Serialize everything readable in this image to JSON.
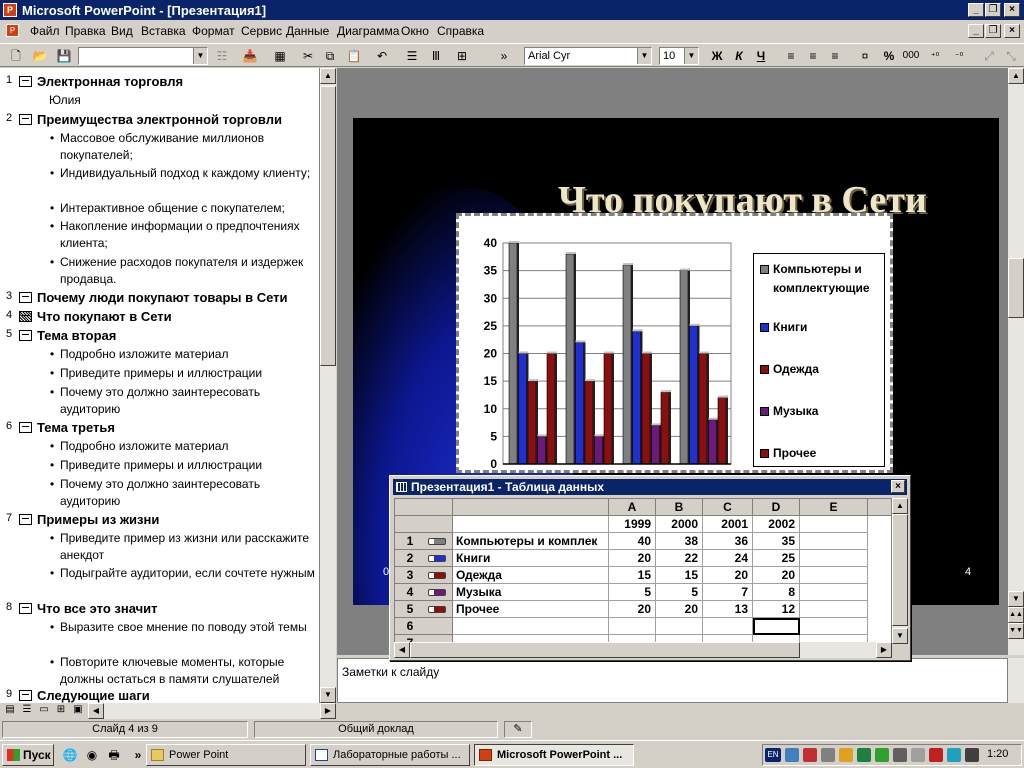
{
  "window": {
    "title": "Microsoft PowerPoint - [Презентация1]"
  },
  "menu": [
    "Файл",
    "Правка",
    "Вид",
    "Вставка",
    "Формат",
    "Сервис",
    "Данные",
    "Диаграмма",
    "Окно",
    "Справка"
  ],
  "toolbar": {
    "font": "Arial Cyr",
    "size": "10",
    "bold": "Ж",
    "italic": "К",
    "underline": "Ч",
    "percent": "%",
    "thousands": "000"
  },
  "outline": [
    {
      "n": "1",
      "title": "Электронная торговля",
      "sub": "Юлия",
      "bullets": []
    },
    {
      "n": "2",
      "title": "Преимущества электронной торговли",
      "bullets": [
        " Массовое обслуживание миллионов покупателей;",
        " Индивидуальный подход к каждому клиенту;",
        " Интерактивное общение с покупателем;",
        " Накопление информации о предпочтениях клиента;",
        " Снижение расходов покупателя и издержек продавца."
      ]
    },
    {
      "n": "3",
      "title": "Почему люди покупают товары в Сети",
      "bullets": []
    },
    {
      "n": "4",
      "title": "Что покупают в Сети",
      "bullets": []
    },
    {
      "n": "5",
      "title": "Тема вторая",
      "bullets": [
        "Подробно изложите материал",
        "Приведите примеры и иллюстрации",
        "Почему это должно заинтересовать аудиторию"
      ]
    },
    {
      "n": "6",
      "title": "Тема третья",
      "bullets": [
        "Подробно изложите материал",
        "Приведите примеры и иллюстрации",
        "Почему это должно заинтересовать аудиторию"
      ]
    },
    {
      "n": "7",
      "title": "Примеры из жизни",
      "bullets": [
        "Приведите пример из жизни или расскажите анекдот",
        "Подыграйте аудитории, если сочтете нужным"
      ]
    },
    {
      "n": "8",
      "title": "Что все это значит",
      "bullets": [
        "Выразите свое мнение по поводу этой темы",
        "Повторите ключевые моменты, которые должны остаться в памяти слушателей"
      ]
    },
    {
      "n": "9",
      "title": "Следующие шаги",
      "bullets": []
    }
  ],
  "slide": {
    "title": "Что покупают в Сети",
    "footer_left": "0",
    "footer_right": "4"
  },
  "chart_data": {
    "type": "bar",
    "title": "",
    "categories": [
      "1999",
      "2000",
      "2001",
      "2002"
    ],
    "ylim": [
      0,
      40
    ],
    "yticks": [
      0,
      5,
      10,
      15,
      20,
      25,
      30,
      35,
      40
    ],
    "legend": "right",
    "grid": true,
    "series": [
      {
        "name": "Компьютеры и комплектующие",
        "values": [
          40,
          38,
          36,
          35
        ],
        "color": "#808080"
      },
      {
        "name": "Книги",
        "values": [
          20,
          22,
          24,
          25
        ],
        "color": "#2030d0"
      },
      {
        "name": "Одежда",
        "values": [
          15,
          15,
          20,
          20
        ],
        "color": "#8a1010"
      },
      {
        "name": "Музыка",
        "values": [
          5,
          5,
          7,
          8
        ],
        "color": "#6a1a7a"
      },
      {
        "name": "Прочее",
        "values": [
          20,
          20,
          13,
          12
        ],
        "color": "#8a1010"
      }
    ]
  },
  "datasheet": {
    "title": "Презентация1 - Таблица данных",
    "cols": [
      "A",
      "B",
      "C",
      "D",
      "E"
    ],
    "years": [
      "1999",
      "2000",
      "2001",
      "2002"
    ],
    "rows": [
      {
        "n": "1",
        "label": "Компьютеры и комплек",
        "vals": [
          "40",
          "38",
          "36",
          "35"
        ]
      },
      {
        "n": "2",
        "label": "Книги",
        "vals": [
          "20",
          "22",
          "24",
          "25"
        ]
      },
      {
        "n": "3",
        "label": "Одежда",
        "vals": [
          "15",
          "15",
          "20",
          "20"
        ]
      },
      {
        "n": "4",
        "label": "Музыка",
        "vals": [
          "5",
          "5",
          "7",
          "8"
        ]
      },
      {
        "n": "5",
        "label": "Прочее",
        "vals": [
          "20",
          "20",
          "13",
          "12"
        ]
      },
      {
        "n": "6",
        "label": "",
        "vals": [
          "",
          "",
          "",
          ""
        ]
      },
      {
        "n": "7",
        "label": "",
        "vals": [
          "",
          "",
          "",
          ""
        ]
      }
    ]
  },
  "notes": {
    "placeholder": "Заметки к слайду"
  },
  "status": {
    "slide": "Слайд 4 из 9",
    "design": "Общий доклад"
  },
  "taskbar": {
    "start": "Пуск",
    "tasks": [
      "Power Point",
      "Лабораторные работы ...",
      "Microsoft PowerPoint ..."
    ],
    "clock": "1:20",
    "lang": "EN"
  }
}
